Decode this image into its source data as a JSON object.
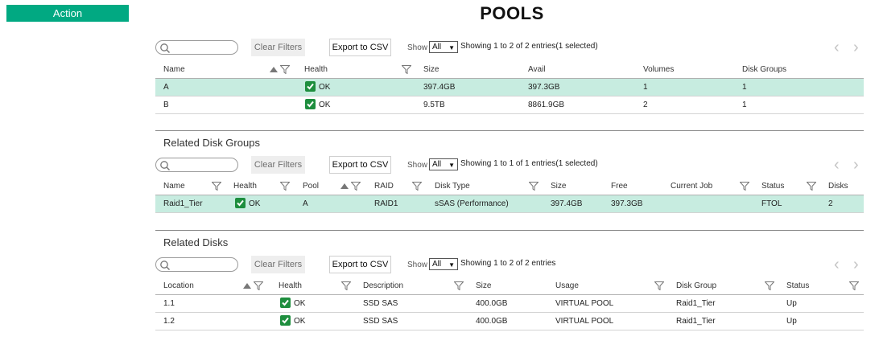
{
  "action_button": "Action",
  "page_title": "POOLS",
  "toolbar": {
    "search_placeholder": "",
    "clear_filters": "Clear Filters",
    "export": "Export to CSV",
    "show": "Show",
    "page_size": "All"
  },
  "pools": {
    "showing": "Showing 1 to 2 of 2 entries(1 selected)",
    "headers": [
      "Name",
      "Health",
      "Size",
      "Avail",
      "Volumes",
      "Disk Groups"
    ],
    "rows": [
      {
        "name": "A",
        "health": "OK",
        "size": "397.4GB",
        "avail": "397.3GB",
        "volumes": "1",
        "disk_groups": "1"
      },
      {
        "name": "B",
        "health": "OK",
        "size": "9.5TB",
        "avail": "8861.9GB",
        "volumes": "2",
        "disk_groups": "1"
      }
    ]
  },
  "disk_groups": {
    "title": "Related Disk Groups",
    "showing": "Showing 1 to 1 of 1 entries(1 selected)",
    "headers": [
      "Name",
      "Health",
      "Pool",
      "RAID",
      "Disk Type",
      "Size",
      "Free",
      "Current Job",
      "Status",
      "Disks"
    ],
    "rows": [
      {
        "name": "Raid1_Tier",
        "health": "OK",
        "pool": "A",
        "raid": "RAID1",
        "disk_type": "sSAS (Performance)",
        "size": "397.4GB",
        "free": "397.3GB",
        "current_job": "",
        "status": "FTOL",
        "disks": "2"
      }
    ]
  },
  "disks": {
    "title": "Related Disks",
    "showing": "Showing 1 to 2 of 2 entries",
    "headers": [
      "Location",
      "Health",
      "Description",
      "Size",
      "Usage",
      "Disk Group",
      "Status"
    ],
    "rows": [
      {
        "location": "1.1",
        "health": "OK",
        "description": "SSD SAS",
        "size": "400.0GB",
        "usage": "VIRTUAL POOL",
        "disk_group": "Raid1_Tier",
        "status": "Up"
      },
      {
        "location": "1.2",
        "health": "OK",
        "description": "SSD SAS",
        "size": "400.0GB",
        "usage": "VIRTUAL POOL",
        "disk_group": "Raid1_Tier",
        "status": "Up"
      }
    ]
  },
  "colors": {
    "accent": "#01a982",
    "selected_row": "#c7ece0",
    "ok_icon": "#1e8e3e"
  },
  "icons": {
    "search": "search-icon",
    "filter": "filter-icon",
    "sort": "sort-asc-icon",
    "ok": "check-icon",
    "prev": "chevron-left-icon",
    "next": "chevron-right-icon"
  }
}
